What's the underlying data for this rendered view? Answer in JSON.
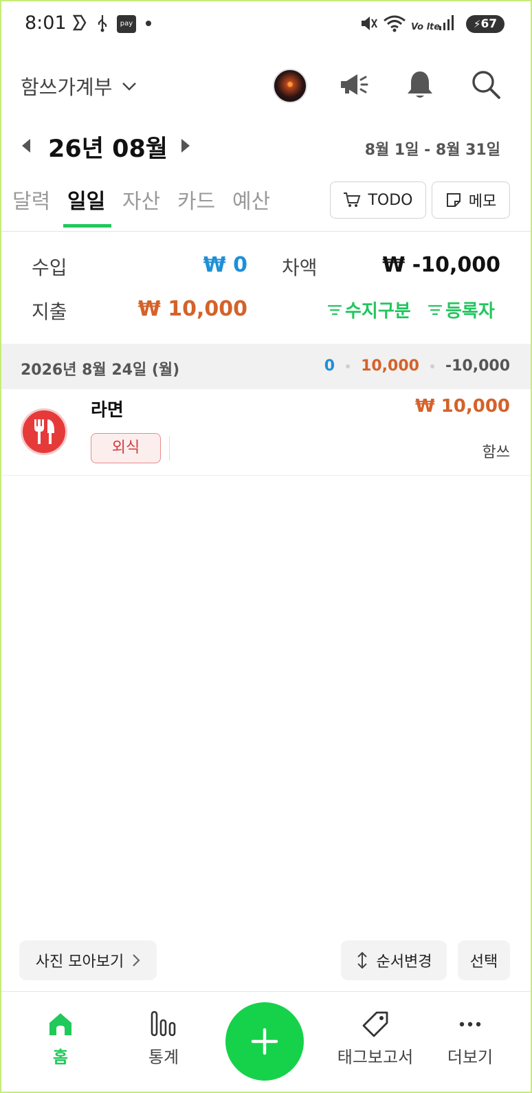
{
  "status_bar": {
    "time": "8:01",
    "pay_label": "pay",
    "lte_label": "Vo lte",
    "battery": "67",
    "icons": [
      "samsung-icon",
      "usb-icon",
      "pay-icon",
      "dot-icon",
      "mute-icon",
      "wifi-icon",
      "volte-icon",
      "signal-icon",
      "battery-icon"
    ]
  },
  "header": {
    "app_title": "함쓰가계부",
    "icons": [
      "chevron-down-icon",
      "avatar",
      "megaphone-icon",
      "bell-icon",
      "search-icon"
    ]
  },
  "month": {
    "label": "26년 08월",
    "range": "8월 1일 - 8월 31일"
  },
  "tabs": [
    {
      "label": "달력",
      "active": false
    },
    {
      "label": "일일",
      "active": true
    },
    {
      "label": "자산",
      "active": false
    },
    {
      "label": "카드",
      "active": false
    },
    {
      "label": "예산",
      "active": false
    }
  ],
  "buttons": {
    "todo": "TODO",
    "memo": "메모"
  },
  "summary": {
    "income_label": "수입",
    "income_value": "₩ 0",
    "expense_label": "지출",
    "expense_value": "₩ 10,000",
    "diff_label": "차액",
    "diff_value": "₩ -10,000",
    "filter_category": "수지구분",
    "filter_author": "등록자"
  },
  "day": {
    "date": "2026년 8월 24일 (월)",
    "income": "0",
    "expense": "10,000",
    "diff": "-10,000"
  },
  "entries": [
    {
      "title": "라면",
      "amount": "₩ 10,000",
      "tag": "외식",
      "author": "함쓰",
      "icon": "fork-knife-icon"
    }
  ],
  "actions": {
    "photos": "사진 모아보기",
    "reorder": "순서변경",
    "select": "선택"
  },
  "nav": {
    "home": "홈",
    "stats": "통계",
    "tag_report": "태그보고서",
    "more": "더보기"
  },
  "colors": {
    "accent": "#1fc95a",
    "income": "#1e90d6",
    "expense": "#d4622a",
    "fab": "#16d24a"
  }
}
